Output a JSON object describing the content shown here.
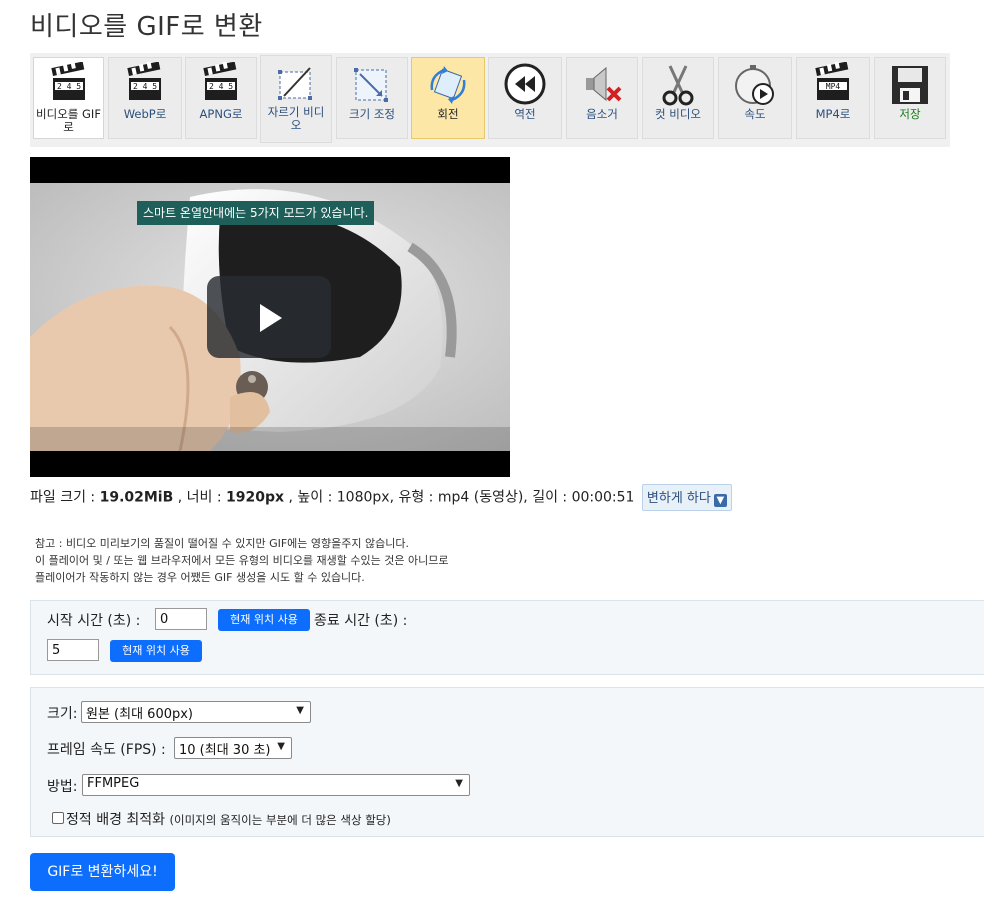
{
  "page": {
    "title": "비디오를 GIF로 변환"
  },
  "toolbar": {
    "items": [
      {
        "label": "비디오를 GIF로",
        "icon": "clapperboard-icon",
        "state": "selected"
      },
      {
        "label": "WebP로",
        "icon": "clapperboard-icon"
      },
      {
        "label": "APNG로",
        "icon": "clapperboard-icon"
      },
      {
        "label": "자르기 비디오",
        "icon": "crop-icon"
      },
      {
        "label": "크기 조정",
        "icon": "resize-icon"
      },
      {
        "label": "회전",
        "icon": "rotate-icon",
        "state": "active"
      },
      {
        "label": "역전",
        "icon": "rewind-icon"
      },
      {
        "label": "음소거",
        "icon": "mute-icon"
      },
      {
        "label": "컷 비디오",
        "icon": "scissors-icon"
      },
      {
        "label": "속도",
        "icon": "stopwatch-icon"
      },
      {
        "label": "MP4로",
        "icon": "mp4-icon",
        "badge": "MP4"
      },
      {
        "label": "저장",
        "icon": "floppy-disk-icon"
      }
    ],
    "clapper_numbers": "2 4 5"
  },
  "video": {
    "caption": "스마트 온열안대에는 5가지 모드가 있습니다.",
    "play_icon": "play-icon"
  },
  "file_info": {
    "size_label": "파일 크기 : ",
    "size_value": "19.02MiB",
    "width_label": " , 너비 : ",
    "width_value": "1920px",
    "rest": " , 높이 : 1080px, 유형 : mp4 (동영상), 길이 : 00:00:51",
    "change_button": "변하게 하다",
    "change_icon": "download-arrow-icon"
  },
  "note": {
    "lines": [
      "참고 : 비디오 미리보기의 품질이 떨어질 수 있지만 GIF에는 영향을주지 않습니다.",
      "이 플레이어 및 / 또는 웹 브라우저에서 모든 유형의 비디오를 재생할 수있는 것은 아니므로",
      "플레이어가 작동하지 않는 경우 어쨌든 GIF 생성을 시도 할 수 있습니다."
    ]
  },
  "time": {
    "start_label": "시작 시간 (초) :",
    "start_value": "0",
    "use_current_1": "현재 위치 사용",
    "end_label": "종료 시간 (초) :",
    "end_value": "5",
    "use_current_2": "현재 위치 사용"
  },
  "options": {
    "size_label": "크기:",
    "size_value": "원본 (최대 600px)",
    "fps_label": "프레임 속도 (FPS) :",
    "fps_value": "10 (최대 30 초)",
    "method_label": "방법:",
    "method_value": "FFMPEG",
    "static_bg_label": "정적 배경 최적화",
    "static_bg_hint": "(이미지의 움직이는 부분에 더 많은 색상 할당)",
    "static_bg_checked": false
  },
  "submit_label": "GIF로 변환하세요!",
  "colors": {
    "primary": "#0d6efd",
    "toolbar_active": "#fde7a6",
    "caption_bg": "#1f5f5a"
  }
}
